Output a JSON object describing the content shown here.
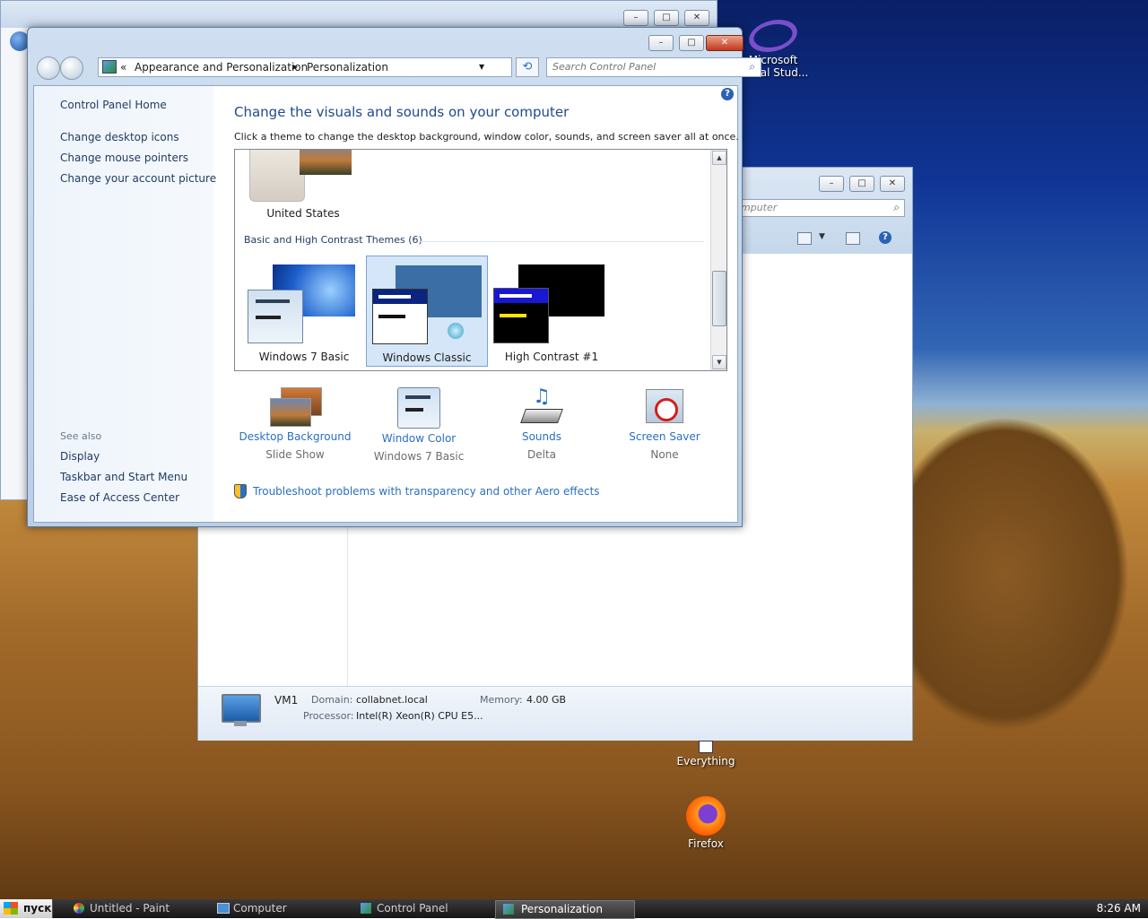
{
  "desktop": {
    "icons": [
      {
        "label_line1": "Microsoft",
        "label_line2": "Visual Stud...",
        "icon": "visual-studio-icon"
      },
      {
        "label": "Everything",
        "icon": "everything-icon"
      },
      {
        "label": "Firefox",
        "icon": "firefox-icon"
      }
    ]
  },
  "background_window": {
    "search_placeholder": "mputer",
    "computer_name": "VM1",
    "domain_label": "Domain:",
    "domain_value": "collabnet.local",
    "memory_label": "Memory:",
    "memory_value": "4.00 GB",
    "processor_label": "Processor:",
    "processor_value": "Intel(R) Xeon(R) CPU E5..."
  },
  "window": {
    "title_buttons": {
      "minimize": "–",
      "maximize": "□",
      "close": "✕"
    },
    "breadcrumb": {
      "chevrons": "«",
      "items": [
        "Appearance and Personalization",
        "Personalization"
      ],
      "separator": "▶",
      "dropdown": "▼"
    },
    "refresh_icon": "⟲",
    "search": {
      "placeholder": "Search Control Panel",
      "icon": "⌕"
    },
    "help": "?",
    "left_pane": {
      "home": "Control Panel Home",
      "links": [
        "Change desktop icons",
        "Change mouse pointers",
        "Change your account picture"
      ],
      "see_also_heading": "See also",
      "see_also": [
        "Display",
        "Taskbar and Start Menu",
        "Ease of Access Center"
      ]
    },
    "heading": "Change the visuals and sounds on your computer",
    "subheading": "Click a theme to change the desktop background, window color, sounds, and screen saver all at once.",
    "themes": {
      "top_theme_label": "United States",
      "group_heading": "Basic and High Contrast Themes (6)",
      "items": [
        {
          "label": "Windows 7 Basic",
          "selected": false
        },
        {
          "label": "Windows Classic",
          "selected": true
        },
        {
          "label": "High Contrast #1",
          "selected": false
        }
      ],
      "scroll_up": "▲",
      "scroll_down": "▼"
    },
    "bottom": [
      {
        "title": "Desktop Background",
        "value": "Slide Show",
        "icon": "desktop-background-icon"
      },
      {
        "title": "Window Color",
        "value": "Windows 7 Basic",
        "icon": "window-color-icon"
      },
      {
        "title": "Sounds",
        "value": "Delta",
        "icon": "sounds-icon"
      },
      {
        "title": "Screen Saver",
        "value": "None",
        "icon": "screen-saver-icon"
      }
    ],
    "troubleshoot": "Troubleshoot problems with transparency and other Aero effects"
  },
  "taskbar": {
    "start_label": "пуск",
    "buttons": [
      {
        "label": "Untitled - Paint",
        "active": false
      },
      {
        "label": "Computer",
        "active": false
      },
      {
        "label": "Control Panel",
        "active": false
      },
      {
        "label": "Personalization",
        "active": true
      }
    ],
    "clock": "8:26 AM"
  },
  "colors": {
    "link": "#2a6fc3",
    "heading": "#1e4a8a",
    "selection": "#d5e6f8"
  }
}
